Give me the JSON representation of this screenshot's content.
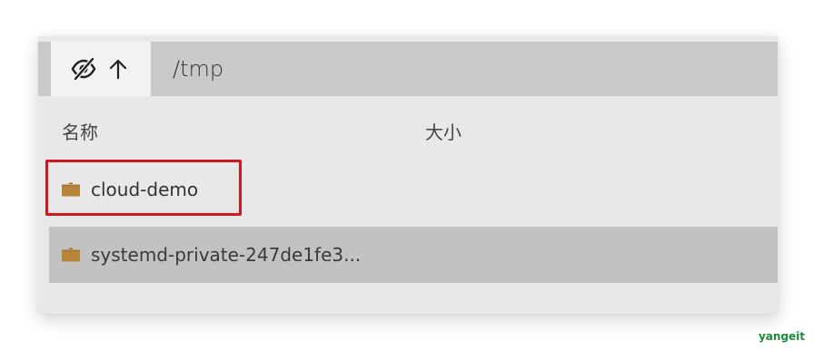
{
  "toolbar": {
    "toggle_hidden_icon": "eye-slash-icon",
    "up_icon": "arrow-up-icon",
    "path": "/tmp"
  },
  "columns": {
    "name": "名称",
    "size": "大小"
  },
  "files": [
    {
      "name": "cloud-demo",
      "type": "folder",
      "icon": "folder-icon",
      "highlighted": true
    },
    {
      "name": "systemd-private-247de1fe3...",
      "type": "folder",
      "icon": "folder-icon",
      "selected": true
    }
  ],
  "colors": {
    "highlight": "#d0161e",
    "folder": "#b8863b",
    "selected_row": "#c2c2c2"
  },
  "watermark": "yangeit"
}
